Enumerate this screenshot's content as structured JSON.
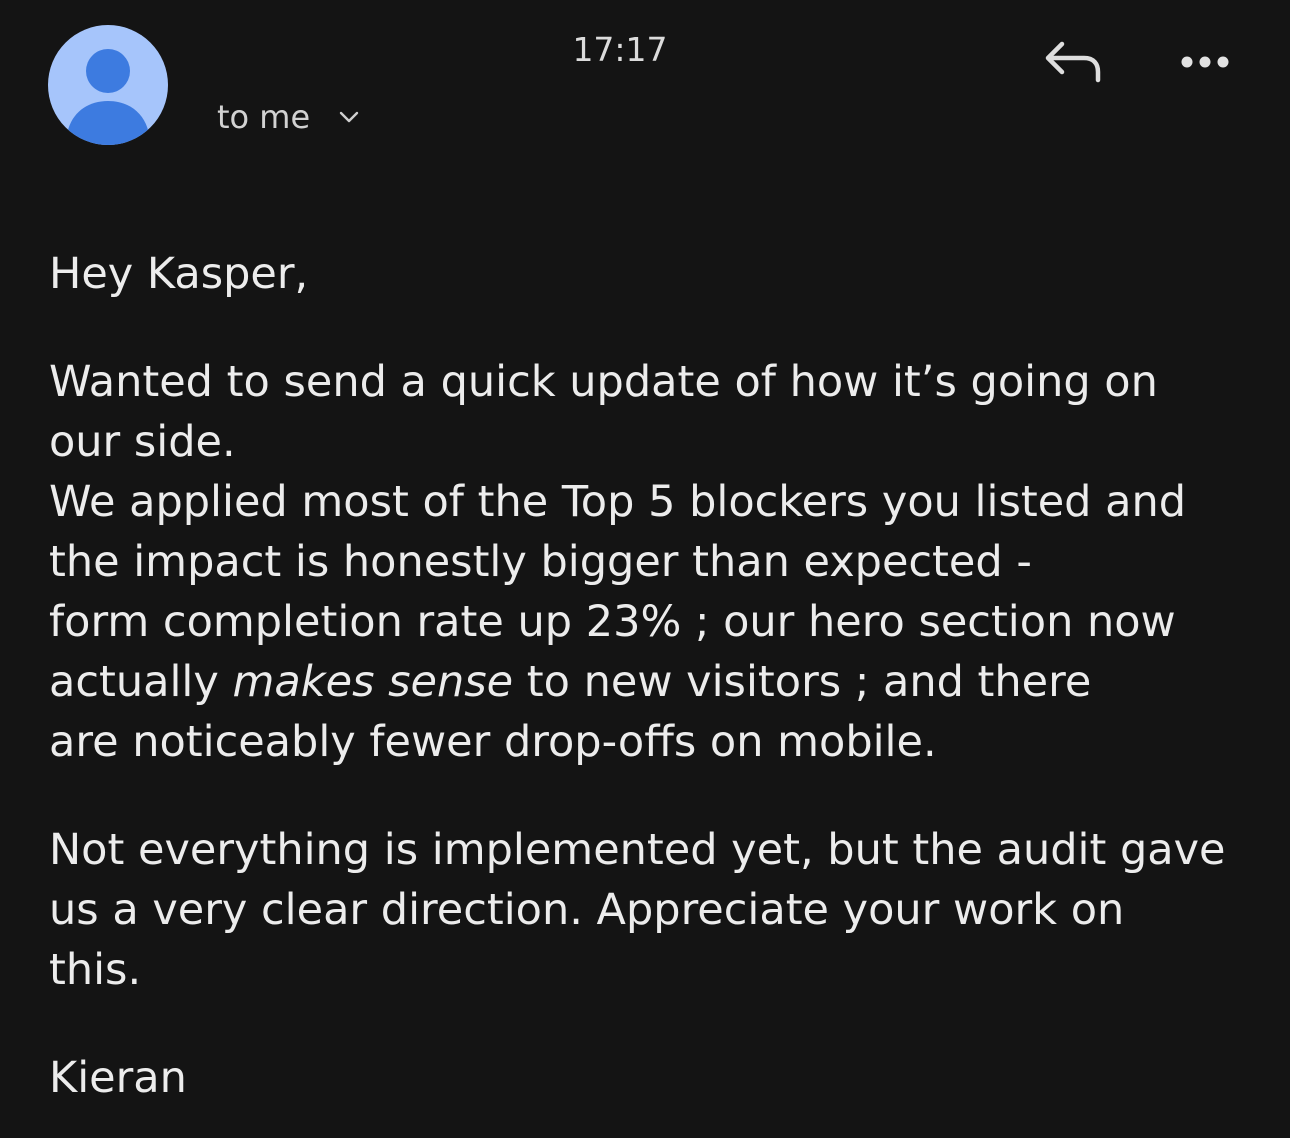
{
  "header": {
    "time": "17:17",
    "recipient_label": "to me"
  },
  "icons": {
    "avatar": "person-avatar-icon",
    "chevron": "chevron-down-icon",
    "reply": "reply-icon",
    "more": "more-horizontal-icon"
  },
  "colors": {
    "background": "#141414",
    "avatar_bg": "#a6c5fb",
    "avatar_fg": "#3d7be0",
    "text": "#ececec"
  },
  "message": {
    "greeting": "Hey Kasper,",
    "para1_lines": [
      "Wanted to send a quick update of how it’s going on",
      "our side.",
      "We applied most of the Top 5 blockers you listed and",
      "the impact is honestly bigger than expected -",
      "form completion rate up 23% ; our hero section now"
    ],
    "para1_line6_before": "actually ",
    "para1_line6_emph": "makes sense",
    "para1_line6_after": " to new visitors ; and there",
    "para1_line7": "are noticeably fewer drop-offs on mobile.",
    "para2_lines": [
      "Not everything is implemented yet, but the audit gave",
      "us a very clear direction. Appreciate your work on",
      "this."
    ],
    "signature": "Kieran"
  }
}
